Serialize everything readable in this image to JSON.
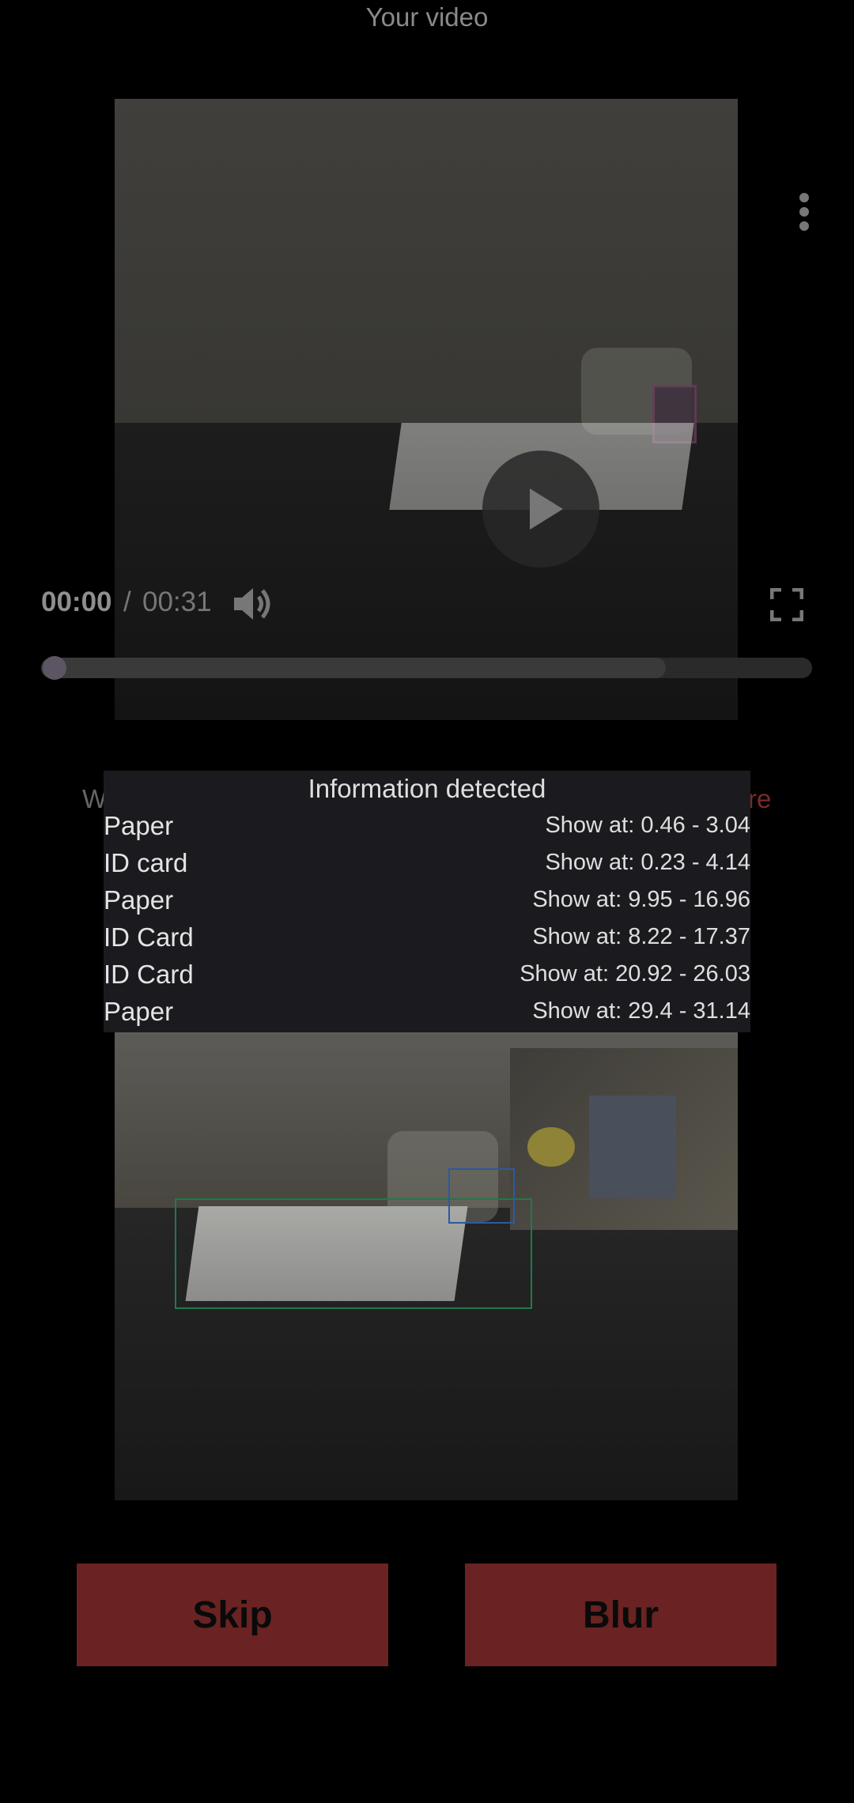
{
  "header": {
    "title": "Your video"
  },
  "player": {
    "current_time": "00:00",
    "separator": "/",
    "total_time": "00:31",
    "progress": 0.0,
    "buffered": 0.81,
    "icons": [
      "play-icon",
      "more-vert-icon",
      "volume-icon",
      "fullscreen-icon"
    ]
  },
  "underlying_text": {
    "left_fragment": "W",
    "right_fragment": "re"
  },
  "info_panel": {
    "title": "Information detected",
    "items": [
      {
        "label": "Paper",
        "time": "Show at: 0.46 - 3.04"
      },
      {
        "label": "ID card",
        "time": "Show at: 0.23 - 4.14"
      },
      {
        "label": "Paper",
        "time": "Show at: 9.95 - 16.96"
      },
      {
        "label": "ID Card",
        "time": "Show at: 8.22 - 17.37"
      },
      {
        "label": "ID Card",
        "time": "Show at: 20.92 - 26.03"
      },
      {
        "label": "Paper",
        "time": "Show at: 29.4 - 31.14"
      }
    ]
  },
  "actions": {
    "skip_label": "Skip",
    "blur_label": "Blur"
  },
  "colors": {
    "background": "#000000",
    "button": "#6a2322",
    "panel": "#1c1b1f",
    "paper_box": "#1f7a4a",
    "card_box": "#2a5aa0"
  }
}
